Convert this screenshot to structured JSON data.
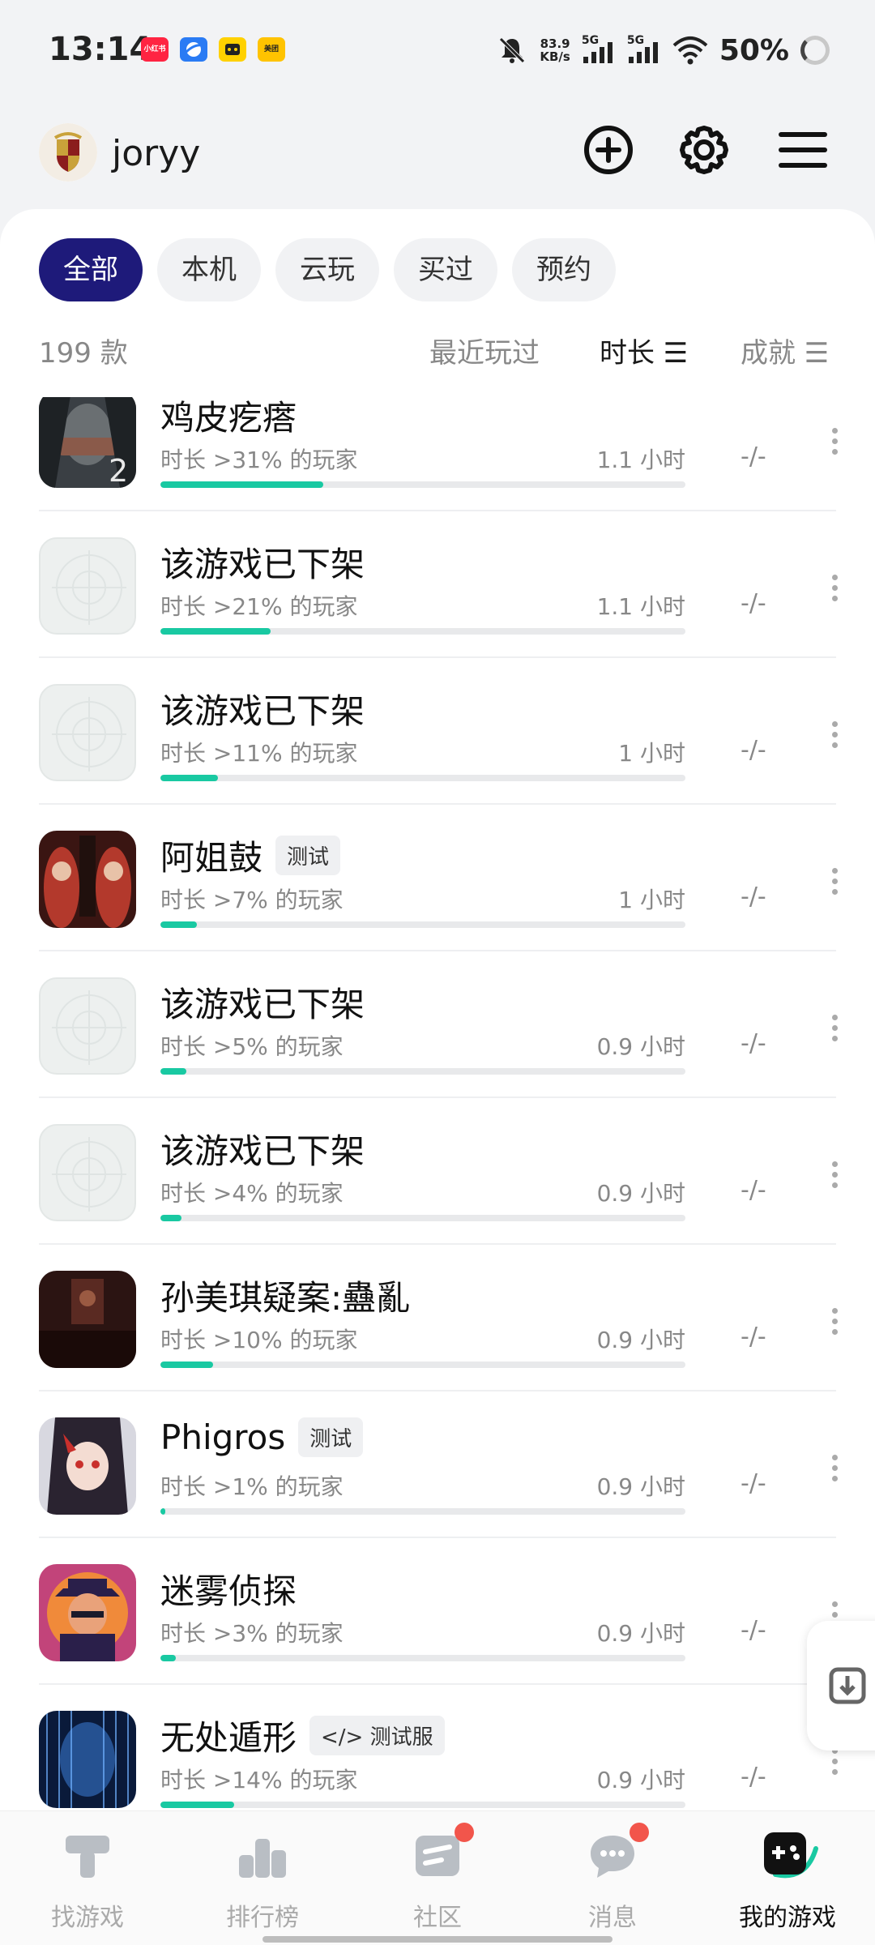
{
  "status_bar": {
    "time": "13:14",
    "apps": [
      {
        "name": "xiaohongshu-icon",
        "label": "小红书",
        "color": "#ff2442"
      },
      {
        "name": "browser-icon",
        "label": "",
        "color": "#2a7bf4"
      },
      {
        "name": "tv-app-icon",
        "label": "",
        "color": "#ffd100"
      },
      {
        "name": "meituan-icon",
        "label": "美团",
        "color": "#ffc300"
      }
    ],
    "net_speed": "83.9",
    "net_unit": "KB/s",
    "sig1": "5G",
    "sig2": "5G",
    "battery": "50%"
  },
  "header": {
    "username": "joryy",
    "add_icon": "plus-circle-icon",
    "settings_icon": "gear-icon",
    "menu_icon": "hamburger-icon"
  },
  "filters": [
    "全部",
    "本机",
    "云玩",
    "买过",
    "预约"
  ],
  "active_filter": 0,
  "list_header": {
    "count": "199 款",
    "sort_recent": "最近玩过",
    "sort_duration": "时长 ☰",
    "sort_achievement": "成就 ☰"
  },
  "games": [
    {
      "name": "鸡皮疙瘩",
      "tag": "",
      "desc": "时长 >31% 的玩家",
      "hours": "1.1 小时",
      "progress": 0.31,
      "achievement": "-/-",
      "icon": "goosebumps-cover",
      "color": "#3a3f44"
    },
    {
      "name": "该游戏已下架",
      "tag": "",
      "desc": "时长 >21% 的玩家",
      "hours": "1.1 小时",
      "progress": 0.21,
      "achievement": "-/-",
      "icon": "blank",
      "color": ""
    },
    {
      "name": "该游戏已下架",
      "tag": "",
      "desc": "时长 >11% 的玩家",
      "hours": "1 小时",
      "progress": 0.11,
      "achievement": "-/-",
      "icon": "blank",
      "color": ""
    },
    {
      "name": "阿姐鼓",
      "tag": "测试",
      "desc": "时长 >7% 的玩家",
      "hours": "1 小时",
      "progress": 0.07,
      "achievement": "-/-",
      "icon": "ajiegu-cover",
      "color": "#7a2a22"
    },
    {
      "name": "该游戏已下架",
      "tag": "",
      "desc": "时长 >5% 的玩家",
      "hours": "0.9 小时",
      "progress": 0.05,
      "achievement": "-/-",
      "icon": "blank",
      "color": ""
    },
    {
      "name": "该游戏已下架",
      "tag": "",
      "desc": "时长 >4% 的玩家",
      "hours": "0.9 小时",
      "progress": 0.04,
      "achievement": "-/-",
      "icon": "blank",
      "color": ""
    },
    {
      "name": "孙美琪疑案:蠱亂",
      "tag": "",
      "desc": "时长 >10% 的玩家",
      "hours": "0.9 小时",
      "progress": 0.1,
      "achievement": "-/-",
      "icon": "sunmeiqi-cover",
      "color": "#3b1a16"
    },
    {
      "name": "Phigros",
      "tag": "测试",
      "desc": "时长 >1% 的玩家",
      "hours": "0.9 小时",
      "progress": 0.01,
      "achievement": "-/-",
      "icon": "phigros-cover",
      "color": "#2b2a3a"
    },
    {
      "name": "迷雾侦探",
      "tag": "",
      "desc": "时长 >3% 的玩家",
      "hours": "0.9 小时",
      "progress": 0.03,
      "achievement": "-/-",
      "icon": "rusty-lake-detective-cover",
      "color": "#b43b6a"
    },
    {
      "name": "无处遁形",
      "tag": "</> 测试服",
      "desc": "时长 >14% 的玩家",
      "hours": "0.9 小时",
      "progress": 0.14,
      "achievement": "-/-",
      "icon": "hiding-cover",
      "color": "#0f2a55"
    }
  ],
  "bottom_nav": [
    {
      "label": "找游戏",
      "icon": "hammer-icon",
      "badge": false
    },
    {
      "label": "排行榜",
      "icon": "podium-icon",
      "badge": false
    },
    {
      "label": "社区",
      "icon": "chat-card-icon",
      "badge": true
    },
    {
      "label": "消息",
      "icon": "message-bubble-icon",
      "badge": true
    },
    {
      "label": "我的游戏",
      "icon": "gamepad-icon",
      "badge": false
    }
  ],
  "active_nav": 4,
  "colors": {
    "accent": "#1e1a7a",
    "progress": "#19c9a2",
    "badge": "#f2554b"
  }
}
